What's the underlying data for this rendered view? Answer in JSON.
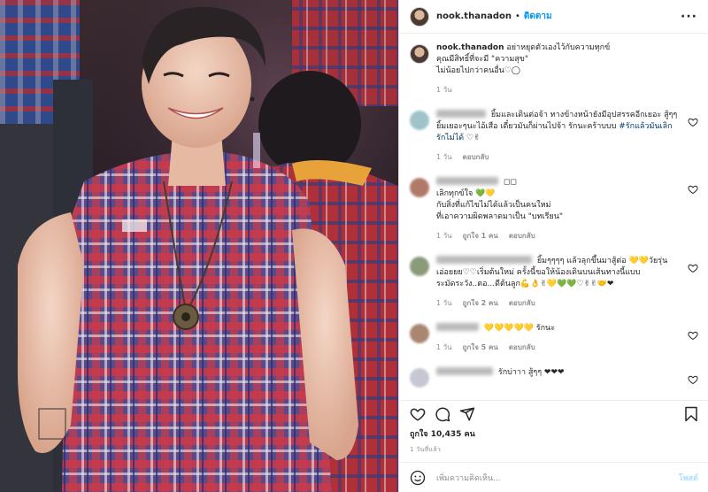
{
  "post": {
    "username": "nook.thanadon",
    "separator": "•",
    "follow_label": "ติดตาม",
    "more_label": "···",
    "caption_line1": "อย่าหยุดตัวเองไว้กับความทุกข์",
    "caption_line2": "คุณมีสิทธิ์ที่จะมี \"ความสุข\"",
    "caption_line3": "ไม่น้อยไปกว่าคนอื่น♡◯",
    "caption_time": "1 วัน"
  },
  "comments": [
    {
      "text": "ยิ้มและเดินต่อจ้า ทางข้างหน้ายังมีอุปสรรคอีกเยอะ สู้ๆๆ ยิ้มเยอะๆนะไอ้เสือ เดี๋ยวมันก็ผ่านไปจ้า รักนะคร้าบบบ ",
      "tag": "#รักแล้วมันเลิกรักไม่ได้",
      "emoji": " ♡✌",
      "time": "1 วัน",
      "likes": "",
      "reply": "ตอบกลับ"
    },
    {
      "text": "◻◻",
      "line2": "เลิกทุกข์ใจ 💚💛",
      "line3": "กับสิ่งที่แก้ไขไม่ได้แล้วเป็นคนใหม่",
      "line4": "ที่เอาความผิดพลาดมาเป็น \"บทเรียน\"",
      "time": "1 วัน",
      "likes": "ถูกใจ 1 คน",
      "reply": "ตอบกลับ"
    },
    {
      "text": "ยิ้มๆๆๆๆ แล้วลุกขึ้นมาสู้ต่อ 💛💛วัยรุ่น",
      "line2": "เอ่อยยย♡♡เริ่มต้นใหม่ ครั้งนี้ขอให้น้องเดินบนเส้นทางนี้แบบ",
      "line3": "ระมัดระวัง..ตอ...ดีต้นลูก💪👌✌💛💚💚♡✌✌🤝❤",
      "time": "1 วัน",
      "likes": "ถูกใจ 2 คน",
      "reply": "ตอบกลับ"
    },
    {
      "text": "💛💛💛💛💛 รักนะ",
      "time": "1 วัน",
      "likes": "ถูกใจ 5 คน",
      "reply": "ตอบกลับ"
    },
    {
      "text": "รักบ่าาา สู้ๆๆ ❤❤❤"
    }
  ],
  "footer": {
    "likes_label": "ถูกใจ 10,435 คน",
    "time_ago": "1 วันที่แล้ว",
    "add_comment_placeholder": "เพิ่มความคิดเห็น...",
    "post_label": "โพสต์"
  },
  "icons": {
    "like": "heart-icon",
    "comment": "comment-icon",
    "share": "send-icon",
    "save": "bookmark-icon",
    "emoji": "emoji-icon"
  },
  "colors": {
    "follow": "#0095f6",
    "post_disabled": "#b2dffc",
    "muted": "#8e8e8e"
  }
}
